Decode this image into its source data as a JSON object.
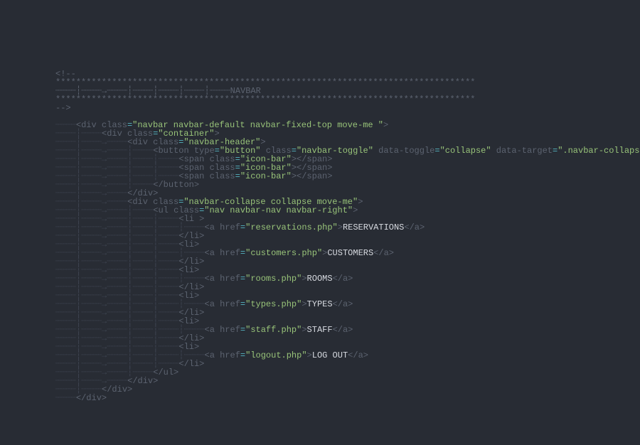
{
  "comment": {
    "open": "<!--",
    "stars1": "**********************************************************************************",
    "label_prefix": "┈┈┈┈┆┈┈┈┈→┈┈┈┈┆┈┈┈┈┆┈┈┈┈┆┈┈┈┈┆┈┈┈┈NAVBAR",
    "stars2": "**********************************************************************************",
    "close": "-->"
  },
  "ws": {
    "i1": "┈┈┈┈",
    "i2": "┈┈┈┈┆┈┈┈┈",
    "i3": "┈┈┈┈┆┈┈┈┈→┈┈┈┈",
    "i4": "┈┈┈┈┆┈┈┈┈→┈┈┈┈┆┈┈┈┈",
    "i5": "┈┈┈┈┆┈┈┈┈→┈┈┈┈┆┈┈┈┈┆┈┈┈┈",
    "i6": "┈┈┈┈┆┈┈┈┈→┈┈┈┈┆┈┈┈┈┆┈┈┈┈┆┈┈┈┈",
    "i7": "┈┈┈┈┆┈┈┈┈→┈┈┈┈┆┈┈┈┈┆┈┈┈┈┆┈┈┈┈┆┈┈┈┈"
  },
  "classes": {
    "navbar": "\"navbar navbar-default navbar-fixed-top move-me \"",
    "container": "\"container\"",
    "navbar_header": "\"navbar-header\"",
    "button_type": "\"button\"",
    "navbar_toggle": "\"navbar-toggle\"",
    "collapse": "\"collapse\"",
    "target": "\".navbar-collapse\"",
    "icon_bar": "\"icon-bar\"",
    "navbar_collapse": "\"navbar-collapse collapse move-me\"",
    "nav_ul": "\"nav navbar-nav navbar-right\""
  },
  "attrs": {
    "class": "class",
    "type": "type",
    "data_toggle": "data-toggle",
    "data_target": "data-target",
    "href": "href"
  },
  "links": [
    {
      "href": "\"reservations.php\"",
      "text": "RESERVATIONS"
    },
    {
      "href": "\"customers.php\"",
      "text": "CUSTOMERS"
    },
    {
      "href": "\"rooms.php\"",
      "text": "ROOMS"
    },
    {
      "href": "\"types.php\"",
      "text": "TYPES"
    },
    {
      "href": "\"staff.php\"",
      "text": "STAFF"
    },
    {
      "href": "\"logout.php\"",
      "text": "LOG OUT"
    }
  ]
}
